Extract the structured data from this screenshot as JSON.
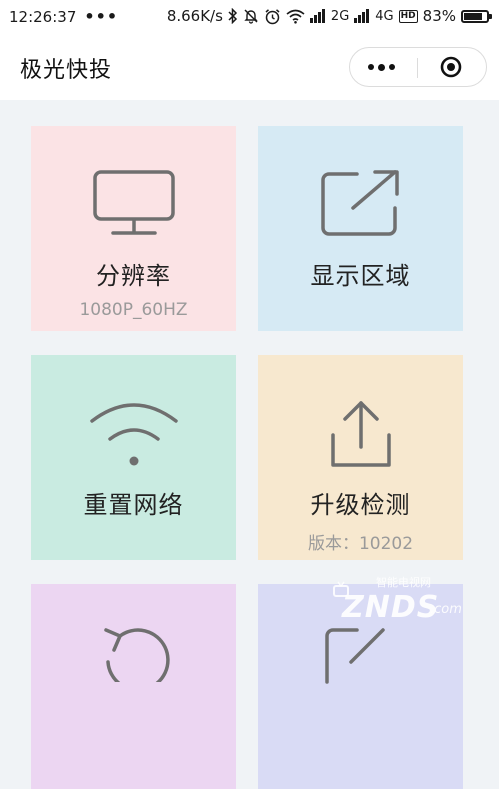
{
  "status_bar": {
    "time": "12:26:37",
    "dots": "•••",
    "speed": "8.66K/s",
    "net1": "2G",
    "net2": "4G",
    "hd": "HD",
    "battery_percent_label": "83%",
    "battery_level": 0.83
  },
  "nav": {
    "title": "极光快投"
  },
  "tiles": [
    {
      "label": "分辨率",
      "sub": "1080P_60HZ",
      "icon": "monitor-icon",
      "color": "#fbe3e5"
    },
    {
      "label": "显示区域",
      "sub": "",
      "icon": "external-link-icon",
      "color": "#d6eaf4"
    },
    {
      "label": "重置网络",
      "sub": "",
      "icon": "wifi-icon",
      "color": "#c9ebe1"
    },
    {
      "label": "升级检测",
      "sub": "版本：10202",
      "icon": "upload-icon",
      "color": "#f7e8cf"
    },
    {
      "label": "",
      "sub": "",
      "icon": "rotate-icon",
      "color": "#ecd6f2"
    },
    {
      "label": "",
      "sub": "",
      "icon": "edit-icon",
      "color": "#d9dbf5"
    }
  ],
  "watermark": {
    "brand": "ZNDS",
    "suffix": ".com",
    "tagline": "智能电视网"
  },
  "colors": {
    "icon_stroke": "#6f6f6f",
    "background": "#f0f3f6"
  }
}
